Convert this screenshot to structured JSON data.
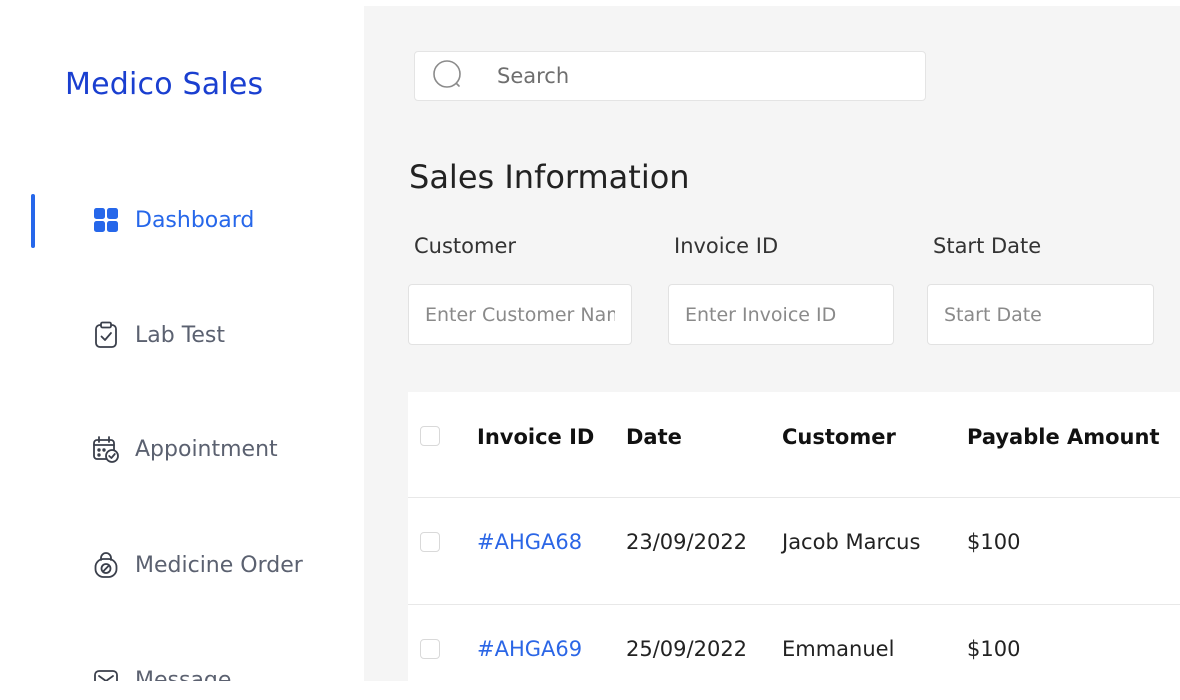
{
  "brand": {
    "name": "Medico Sales"
  },
  "sidebar": {
    "items": [
      {
        "label": "Dashboard",
        "icon": "dashboard-grid-icon",
        "active": true
      },
      {
        "label": "Lab Test",
        "icon": "clipboard-check-icon",
        "active": false
      },
      {
        "label": "Appointment",
        "icon": "calendar-check-icon",
        "active": false
      },
      {
        "label": "Medicine Order",
        "icon": "shopping-bag-icon",
        "active": false
      },
      {
        "label": "Message",
        "icon": "envelope-icon",
        "active": false
      }
    ]
  },
  "search": {
    "placeholder": "Search",
    "icon": "search-icon"
  },
  "page": {
    "title": "Sales Information"
  },
  "filters": {
    "customer": {
      "label": "Customer",
      "placeholder": "Enter Customer Name"
    },
    "invoice": {
      "label": "Invoice ID",
      "placeholder": "Enter Invoice ID"
    },
    "start_date": {
      "label": "Start Date",
      "placeholder": "Start Date"
    }
  },
  "table": {
    "headers": [
      "Invoice ID",
      "Date",
      "Customer",
      "Payable Amount"
    ],
    "rows": [
      {
        "invoice": "#AHGA68",
        "date": "23/09/2022",
        "customer": "Jacob Marcus",
        "amount": "$100"
      },
      {
        "invoice": "#AHGA69",
        "date": "25/09/2022",
        "customer": "Emmanuel",
        "amount": "$100"
      }
    ]
  },
  "colors": {
    "accent": "#2667ea",
    "brand": "#1a3fd0",
    "background": "#f5f5f5"
  }
}
